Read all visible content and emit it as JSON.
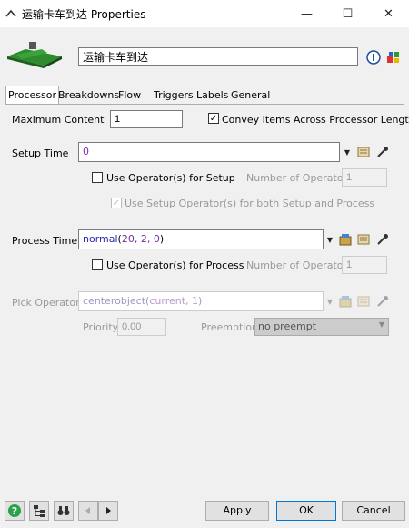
{
  "window": {
    "title": "运输卡车到达  Properties",
    "minimize": "—",
    "maximize": "☐",
    "close": "✕"
  },
  "header": {
    "object_name": "运输卡车到达"
  },
  "tabs": [
    {
      "label": "Processor",
      "active": true
    },
    {
      "label": "Breakdowns"
    },
    {
      "label": "Flow"
    },
    {
      "label": "Triggers"
    },
    {
      "label": "Labels"
    },
    {
      "label": "General"
    }
  ],
  "processor": {
    "max_content_label": "Maximum Content",
    "max_content_value": "1",
    "convey_label": "Convey Items Across Processor Length",
    "convey_checked": true,
    "setup_time_label": "Setup Time",
    "setup_time_value": "0",
    "use_operator_setup_label": "Use Operator(s) for Setup",
    "num_operators_label": "Number of Operators",
    "num_operators_setup_value": "1",
    "use_setup_for_both_label": "Use Setup Operator(s) for both Setup and Process",
    "process_time_label": "Process Time",
    "process_time_fn": "normal",
    "process_time_args": "20, 2, 0",
    "use_operator_process_label": "Use Operator(s) for Process",
    "num_operators_process_value": "1",
    "pick_operator_label": "Pick Operator",
    "pick_operator_fn": "centerobject",
    "pick_operator_args": "current, 1",
    "priority_label": "Priority",
    "priority_value": "0.00",
    "preemption_label": "Preemption",
    "preemption_value": "no preempt"
  },
  "footer": {
    "apply": "Apply",
    "ok": "OK",
    "cancel": "Cancel"
  },
  "colors": {
    "accent": "#0078d7",
    "code_purple": "#7a2ea0"
  }
}
